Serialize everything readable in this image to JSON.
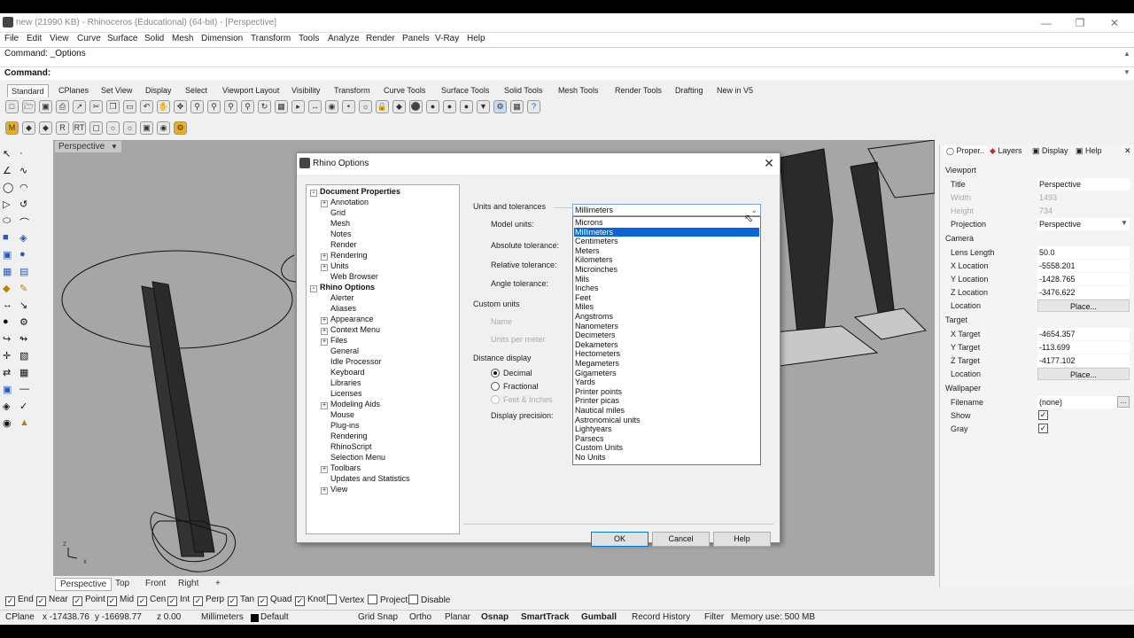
{
  "window": {
    "title": "new (21990 KB) - Rhinoceros (Educational) (64-bit) - [Perspective]"
  },
  "menu": [
    "File",
    "Edit",
    "View",
    "Curve",
    "Surface",
    "Solid",
    "Mesh",
    "Dimension",
    "Transform",
    "Tools",
    "Analyze",
    "Render",
    "Panels",
    "V-Ray",
    "Help"
  ],
  "command": {
    "history": "Command: _Options",
    "prompt": "Command:"
  },
  "toolbar_tabs": [
    "Standard",
    "CPlanes",
    "Set View",
    "Display",
    "Select",
    "Viewport Layout",
    "Visibility",
    "Transform",
    "Curve Tools",
    "Surface Tools",
    "Solid Tools",
    "Mesh Tools",
    "Render Tools",
    "Drafting",
    "New in V5"
  ],
  "viewport": {
    "label": "Perspective",
    "tabs": [
      "Perspective",
      "Top",
      "Front",
      "Right"
    ],
    "add_tab": "+"
  },
  "osnap": [
    {
      "label": "End",
      "checked": true
    },
    {
      "label": "Near",
      "checked": true
    },
    {
      "label": "Point",
      "checked": true
    },
    {
      "label": "Mid",
      "checked": true
    },
    {
      "label": "Cen",
      "checked": true
    },
    {
      "label": "Int",
      "checked": true
    },
    {
      "label": "Perp",
      "checked": true
    },
    {
      "label": "Tan",
      "checked": true
    },
    {
      "label": "Quad",
      "checked": true
    },
    {
      "label": "Knot",
      "checked": true
    },
    {
      "label": "Vertex",
      "checked": false
    },
    {
      "label": "Project",
      "checked": false
    },
    {
      "label": "Disable",
      "checked": false
    }
  ],
  "status": {
    "cplane": "CPlane",
    "x": "x -17438.76",
    "y": "y -16698.77",
    "z": "z 0.00",
    "units": "Millimeters",
    "layer": "Default",
    "grid_snap": "Grid Snap",
    "ortho": "Ortho",
    "planar": "Planar",
    "osnap": "Osnap",
    "smarttrack": "SmartTrack",
    "gumball": "Gumball",
    "record_history": "Record History",
    "filter": "Filter",
    "memory": "Memory use: 500 MB"
  },
  "panel": {
    "tabs": [
      "Proper..",
      "Layers",
      "Display",
      "Help"
    ],
    "viewport_section": "Viewport",
    "title_label": "Title",
    "title_value": "Perspective",
    "width_label": "Width",
    "width_value": "1493",
    "height_label": "Height",
    "height_value": "734",
    "projection_label": "Projection",
    "projection_value": "Perspective",
    "camera_section": "Camera",
    "lens_label": "Lens Length",
    "lens_value": "50.0",
    "xloc_label": "X Location",
    "xloc_value": "-5558.201",
    "yloc_label": "Y Location",
    "yloc_value": "-1428.765",
    "zloc_label": "Z Location",
    "zloc_value": "-3476.622",
    "cam_location_label": "Location",
    "place_button": "Place...",
    "target_section": "Target",
    "xt_label": "X Target",
    "xt_value": "-4654.357",
    "yt_label": "Y Target",
    "yt_value": "-113.699",
    "zt_label": "Z Target",
    "zt_value": "-4177.102",
    "tgt_location_label": "Location",
    "wallpaper_section": "Wallpaper",
    "filename_label": "Filename",
    "filename_value": "(none)",
    "show_label": "Show",
    "gray_label": "Gray"
  },
  "dialog": {
    "title": "Rhino Options",
    "tree": [
      {
        "label": "Document Properties",
        "level": 0,
        "bold": true,
        "exp": "-"
      },
      {
        "label": "Annotation",
        "level": 1,
        "exp": "+"
      },
      {
        "label": "Grid",
        "level": 1,
        "exp": ""
      },
      {
        "label": "Mesh",
        "level": 1,
        "exp": ""
      },
      {
        "label": "Notes",
        "level": 1,
        "exp": ""
      },
      {
        "label": "Render",
        "level": 1,
        "exp": ""
      },
      {
        "label": "Rendering",
        "level": 1,
        "exp": "+"
      },
      {
        "label": "Units",
        "level": 1,
        "exp": "+"
      },
      {
        "label": "Web Browser",
        "level": 1,
        "exp": ""
      },
      {
        "label": "Rhino Options",
        "level": 0,
        "bold": true,
        "exp": "-"
      },
      {
        "label": "Alerter",
        "level": 1,
        "exp": ""
      },
      {
        "label": "Aliases",
        "level": 1,
        "exp": ""
      },
      {
        "label": "Appearance",
        "level": 1,
        "exp": "+"
      },
      {
        "label": "Context Menu",
        "level": 1,
        "exp": "+"
      },
      {
        "label": "Files",
        "level": 1,
        "exp": "+"
      },
      {
        "label": "General",
        "level": 1,
        "exp": ""
      },
      {
        "label": "Idle Processor",
        "level": 1,
        "exp": ""
      },
      {
        "label": "Keyboard",
        "level": 1,
        "exp": ""
      },
      {
        "label": "Libraries",
        "level": 1,
        "exp": ""
      },
      {
        "label": "Licenses",
        "level": 1,
        "exp": ""
      },
      {
        "label": "Modeling Aids",
        "level": 1,
        "exp": "+"
      },
      {
        "label": "Mouse",
        "level": 1,
        "exp": ""
      },
      {
        "label": "Plug-ins",
        "level": 1,
        "exp": ""
      },
      {
        "label": "Rendering",
        "level": 1,
        "exp": ""
      },
      {
        "label": "RhinoScript",
        "level": 1,
        "exp": ""
      },
      {
        "label": "Selection Menu",
        "level": 1,
        "exp": ""
      },
      {
        "label": "Toolbars",
        "level": 1,
        "exp": "+"
      },
      {
        "label": "Updates and Statistics",
        "level": 1,
        "exp": ""
      },
      {
        "label": "View",
        "level": 1,
        "exp": "+"
      }
    ],
    "units_heading": "Units and tolerances",
    "model_units_label": "Model units:",
    "model_units_value": "Millimeters",
    "abs_tol_label": "Absolute tolerance:",
    "rel_tol_label": "Relative tolerance:",
    "angle_tol_label": "Angle tolerance:",
    "custom_units_heading": "Custom units",
    "name_label": "Name",
    "units_per_meter_label": "Units per meter",
    "distance_display_heading": "Distance display",
    "decimal_label": "Decimal",
    "fractional_label": "Fractional",
    "feet_inches_label": "Feet & Inches",
    "display_precision_label": "Display precision:",
    "unit_options": [
      "Microns",
      "Millimeters",
      "Centimeters",
      "Meters",
      "Kilometers",
      "Microinches",
      "Mils",
      "Inches",
      "Feet",
      "Miles",
      "Angstroms",
      "Nanometers",
      "Decimeters",
      "Dekameters",
      "Hectometers",
      "Megameters",
      "Gigameters",
      "Yards",
      "Printer points",
      "Printer picas",
      "Nautical miles",
      "Astronomical units",
      "Lightyears",
      "Parsecs",
      "Custom Units",
      "No Units"
    ],
    "selected_option": "Millimeters",
    "ok_button": "OK",
    "cancel_button": "Cancel",
    "help_button": "Help"
  }
}
